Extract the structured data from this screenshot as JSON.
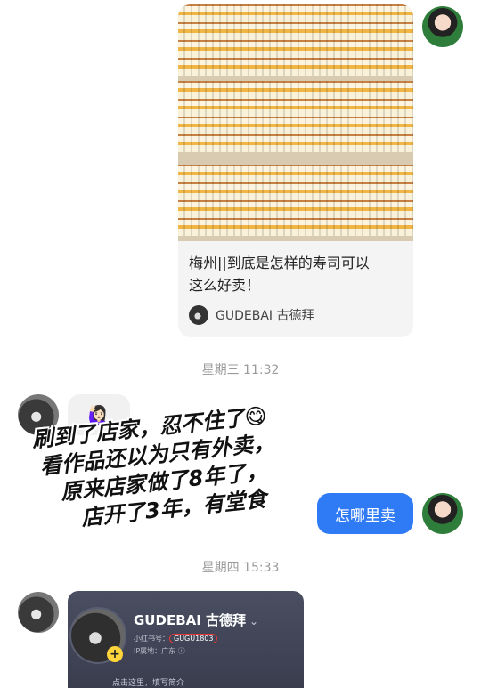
{
  "shared_post": {
    "title_line1": "梅州||到底是怎样的寿司可以",
    "title_line2": "这么好卖！",
    "author": "GUDEBAI 古德拜"
  },
  "timestamps": {
    "wed": "星期三 11:32",
    "thu": "星期四 15:33"
  },
  "received_emoji": "🙋🏻‍♀️",
  "overlay_text": {
    "line1": "刷到了店家，忍不住了😋",
    "line2": "看作品还以为只有外卖，",
    "line3": "原来店家做了8年了，",
    "line4": "店开了3年，有堂食"
  },
  "sent_message": "怎哪里卖",
  "profile_card": {
    "name": "GUDEBAI 古德拜",
    "chevron": "⌄",
    "id_label": "小红书号：",
    "id_value": "GUGU1803",
    "ip": "IP属地：广东 ⓘ",
    "footer": "点击这里，填写简介",
    "plus": "+"
  },
  "icons": {
    "avatar_self": "avatar-girl",
    "avatar_other": "avatar-cat"
  }
}
